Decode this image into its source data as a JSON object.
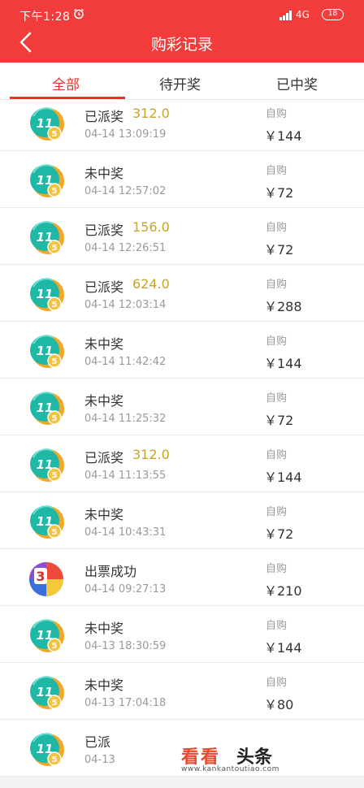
{
  "status_bar": {
    "time": "下午1:28",
    "network": "4G",
    "battery": "18"
  },
  "nav": {
    "title": "购彩记录"
  },
  "tabs": [
    {
      "label": "全部",
      "active": true
    },
    {
      "label": "待开奖",
      "active": false
    },
    {
      "label": "已中奖",
      "active": false
    }
  ],
  "records": [
    {
      "icon": "eleven-five-lottery-icon",
      "status": "已派奖",
      "prize": "312.0",
      "datetime": "04-14 13:09:19",
      "buy_type": "自购",
      "amount": "￥144"
    },
    {
      "icon": "eleven-five-lottery-icon",
      "status": "未中奖",
      "prize": "",
      "datetime": "04-14 12:57:02",
      "buy_type": "自购",
      "amount": "￥72"
    },
    {
      "icon": "eleven-five-lottery-icon",
      "status": "已派奖",
      "prize": "156.0",
      "datetime": "04-14 12:26:51",
      "buy_type": "自购",
      "amount": "￥72"
    },
    {
      "icon": "eleven-five-lottery-icon",
      "status": "已派奖",
      "prize": "624.0",
      "datetime": "04-14 12:03:14",
      "buy_type": "自购",
      "amount": "￥288"
    },
    {
      "icon": "eleven-five-lottery-icon",
      "status": "未中奖",
      "prize": "",
      "datetime": "04-14 11:42:42",
      "buy_type": "自购",
      "amount": "￥144"
    },
    {
      "icon": "eleven-five-lottery-icon",
      "status": "未中奖",
      "prize": "",
      "datetime": "04-14 11:25:32",
      "buy_type": "自购",
      "amount": "￥72"
    },
    {
      "icon": "eleven-five-lottery-icon",
      "status": "已派奖",
      "prize": "312.0",
      "datetime": "04-14 11:13:55",
      "buy_type": "自购",
      "amount": "￥144"
    },
    {
      "icon": "eleven-five-lottery-icon",
      "status": "未中奖",
      "prize": "",
      "datetime": "04-14 10:43:31",
      "buy_type": "自购",
      "amount": "￥72"
    },
    {
      "icon": "three-d-lottery-icon",
      "status": "出票成功",
      "prize": "",
      "datetime": "04-14 09:27:13",
      "buy_type": "自购",
      "amount": "￥210"
    },
    {
      "icon": "eleven-five-lottery-icon",
      "status": "未中奖",
      "prize": "",
      "datetime": "04-13 18:30:59",
      "buy_type": "自购",
      "amount": "￥144"
    },
    {
      "icon": "eleven-five-lottery-icon",
      "status": "未中奖",
      "prize": "",
      "datetime": "04-13 17:04:18",
      "buy_type": "自购",
      "amount": "￥80"
    },
    {
      "icon": "eleven-five-lottery-icon",
      "status": "已派",
      "prize": "",
      "datetime": "04-13",
      "buy_type": "",
      "amount": ""
    }
  ],
  "icon_labels": {
    "eleven": "11",
    "five": "5",
    "three": "3"
  },
  "watermark": {
    "main": "看看",
    "sub": "头条",
    "url": "www.kankantoutiao.com"
  },
  "colors": {
    "header": "#f23b3b",
    "active_tab": "#e8332c",
    "prize": "#c9a227",
    "muted": "#999999"
  }
}
